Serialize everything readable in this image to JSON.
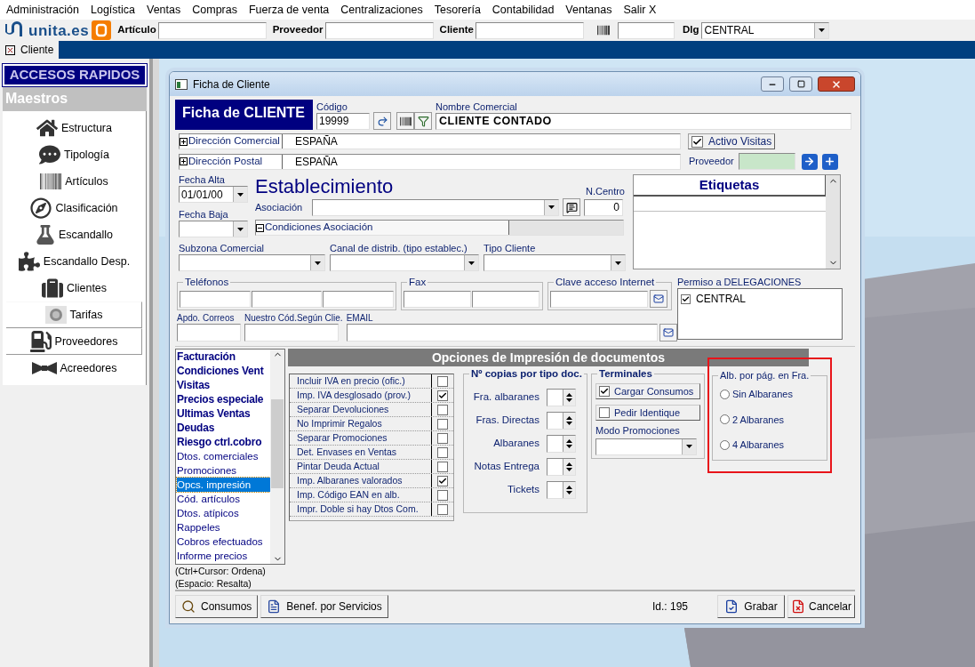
{
  "menu": [
    "Administración",
    "Logística",
    "Ventas",
    "Compras",
    "Fuerza de venta",
    "Centralizaciones",
    "Tesorería",
    "Contabilidad",
    "Ventanas",
    "Salir X"
  ],
  "toolbar": {
    "logo": "unita.es",
    "fields": [
      {
        "label": "Artículo"
      },
      {
        "label": "Proveedor"
      },
      {
        "label": "Cliente"
      }
    ],
    "dlg": {
      "label": "Dlg",
      "value": "CENTRAL"
    }
  },
  "tabs": [
    {
      "label": "Cliente",
      "selected": true
    }
  ],
  "sidebar": {
    "title": "ACCESOS RAPIDOS",
    "section": "Maestros",
    "items": [
      {
        "label": "Estructura",
        "framed": false
      },
      {
        "label": "Tipología",
        "framed": false
      },
      {
        "label": "Artículos",
        "framed": false
      },
      {
        "label": "Clasificación",
        "framed": false
      },
      {
        "label": "Escandallo",
        "framed": false
      },
      {
        "label": "Escandallo Desp.",
        "framed": false
      },
      {
        "label": "Clientes",
        "framed": false
      },
      {
        "label": "Tarifas",
        "framed": true
      },
      {
        "label": "Proveedores",
        "framed": true
      },
      {
        "label": "Acreedores",
        "framed": false
      }
    ]
  },
  "dialog": {
    "title": "Ficha de Cliente",
    "header": "Ficha de CLIENTE",
    "codigo": {
      "label": "Código",
      "value": "19999"
    },
    "nombre": {
      "label": "Nombre Comercial",
      "value": "CLIENTE CONTADO"
    },
    "direcciones": [
      {
        "label": "Dirección Comercial",
        "value": "ESPAÑA",
        "expanded": false
      },
      {
        "label": "Dirección Postal",
        "value": "ESPAÑA",
        "expanded": false
      }
    ],
    "activo_visitas": {
      "label": "Activo Visitas",
      "checked": true
    },
    "proveedor": {
      "label": "Proveedor"
    },
    "fecha_alta": {
      "label": "Fecha Alta",
      "value": "01/01/00"
    },
    "fecha_baja": {
      "label": "Fecha Baja"
    },
    "establecimiento": "Establecimiento",
    "asociacion": {
      "label": "Asociación"
    },
    "n_centro": {
      "label": "N.Centro",
      "value": "0"
    },
    "condiciones": {
      "label": "Condiciones Asociación",
      "expanded": true
    },
    "combos": [
      {
        "label": "Subzona Comercial"
      },
      {
        "label": "Canal de distrib. (tipo establec.)"
      },
      {
        "label": "Tipo Cliente"
      }
    ],
    "etiquetas": {
      "title": "Etiquetas"
    },
    "telefonos": {
      "label": "Teléfonos"
    },
    "fax": {
      "label": "Fax"
    },
    "clave": {
      "label": "Clave acceso Internet"
    },
    "apdo": {
      "label": "Apdo. Correos"
    },
    "cod_cliente": {
      "label": "Nuestro Cód.Según Clie."
    },
    "email": {
      "label": "EMAIL"
    },
    "permiso": {
      "prefix": "Permiso a",
      "label": "DELEGACIONES",
      "items": [
        {
          "label": "CENTRAL",
          "checked": true
        }
      ]
    },
    "sections": [
      {
        "label": "Facturación",
        "bold": true,
        "selected": false
      },
      {
        "label": "Condiciones Vent",
        "bold": true,
        "selected": false
      },
      {
        "label": "Visitas",
        "bold": true,
        "selected": false
      },
      {
        "label": "Precios especiale",
        "bold": true,
        "selected": false
      },
      {
        "label": "Ultimas Ventas",
        "bold": true,
        "selected": false
      },
      {
        "label": "Deudas",
        "bold": true,
        "selected": false
      },
      {
        "label": "Riesgo ctrl.cobro",
        "bold": true,
        "selected": false
      },
      {
        "label": "Dtos. comerciales",
        "bold": false,
        "selected": false
      },
      {
        "label": "Promociones",
        "bold": false,
        "selected": false
      },
      {
        "label": "Opcs. impresión",
        "bold": false,
        "selected": true
      },
      {
        "label": "Cód. artículos",
        "bold": false,
        "selected": false
      },
      {
        "label": "Dtos. atípicos",
        "bold": false,
        "selected": false
      },
      {
        "label": "Rappeles",
        "bold": false,
        "selected": false
      },
      {
        "label": "Cobros efectuados",
        "bold": false,
        "selected": false
      },
      {
        "label": "Informe precios",
        "bold": false,
        "selected": false
      }
    ],
    "hints": [
      "(Ctrl+Cursor: Ordena)",
      "(Espacio: Resalta)"
    ],
    "options": {
      "title": "Opciones de Impresión de documentos",
      "checks": [
        {
          "label": "Incluir IVA en precio (ofic.)",
          "checked": false
        },
        {
          "label": "Imp. IVA desglosado (prov.)",
          "checked": true
        },
        {
          "label": "Separar Devoluciones",
          "checked": false
        },
        {
          "label": "No Imprimir Regalos",
          "checked": false
        },
        {
          "label": "Separar Promociones",
          "checked": false
        },
        {
          "label": "Det. Envases en Ventas",
          "checked": false
        },
        {
          "label": "Pintar Deuda Actual",
          "checked": false
        },
        {
          "label": "Imp. Albaranes valorados",
          "checked": true
        },
        {
          "label": "Imp. Código EAN en alb.",
          "checked": false
        },
        {
          "label": "Impr. Doble si hay Dtos Com.",
          "checked": false
        }
      ],
      "copias": {
        "title": "Nº copias por tipo doc.",
        "rows": [
          "Fra. albaranes",
          "Fras. Directas",
          "Albaranes",
          "Notas Entrega",
          "Tickets"
        ]
      },
      "terminales": {
        "title": "Terminales",
        "toggles": [
          {
            "label": "Cargar Consumos",
            "checked": true
          },
          {
            "label": "Pedir Identique",
            "checked": false
          }
        ],
        "modo": {
          "label": "Modo Promociones"
        }
      },
      "albaranes": {
        "title": "Alb. por pág. en Fra.",
        "highlighted": true,
        "options": [
          {
            "label": "Sin Albaranes",
            "selected": false
          },
          {
            "label": "2 Albaranes",
            "selected": false
          },
          {
            "label": "4 Albaranes",
            "selected": false
          }
        ]
      }
    },
    "footer": {
      "buttons": [
        "Consumos",
        "Benef. por Servicios"
      ],
      "id": "Id.: 195",
      "save": "Grabar",
      "cancel": "Cancelar"
    }
  }
}
